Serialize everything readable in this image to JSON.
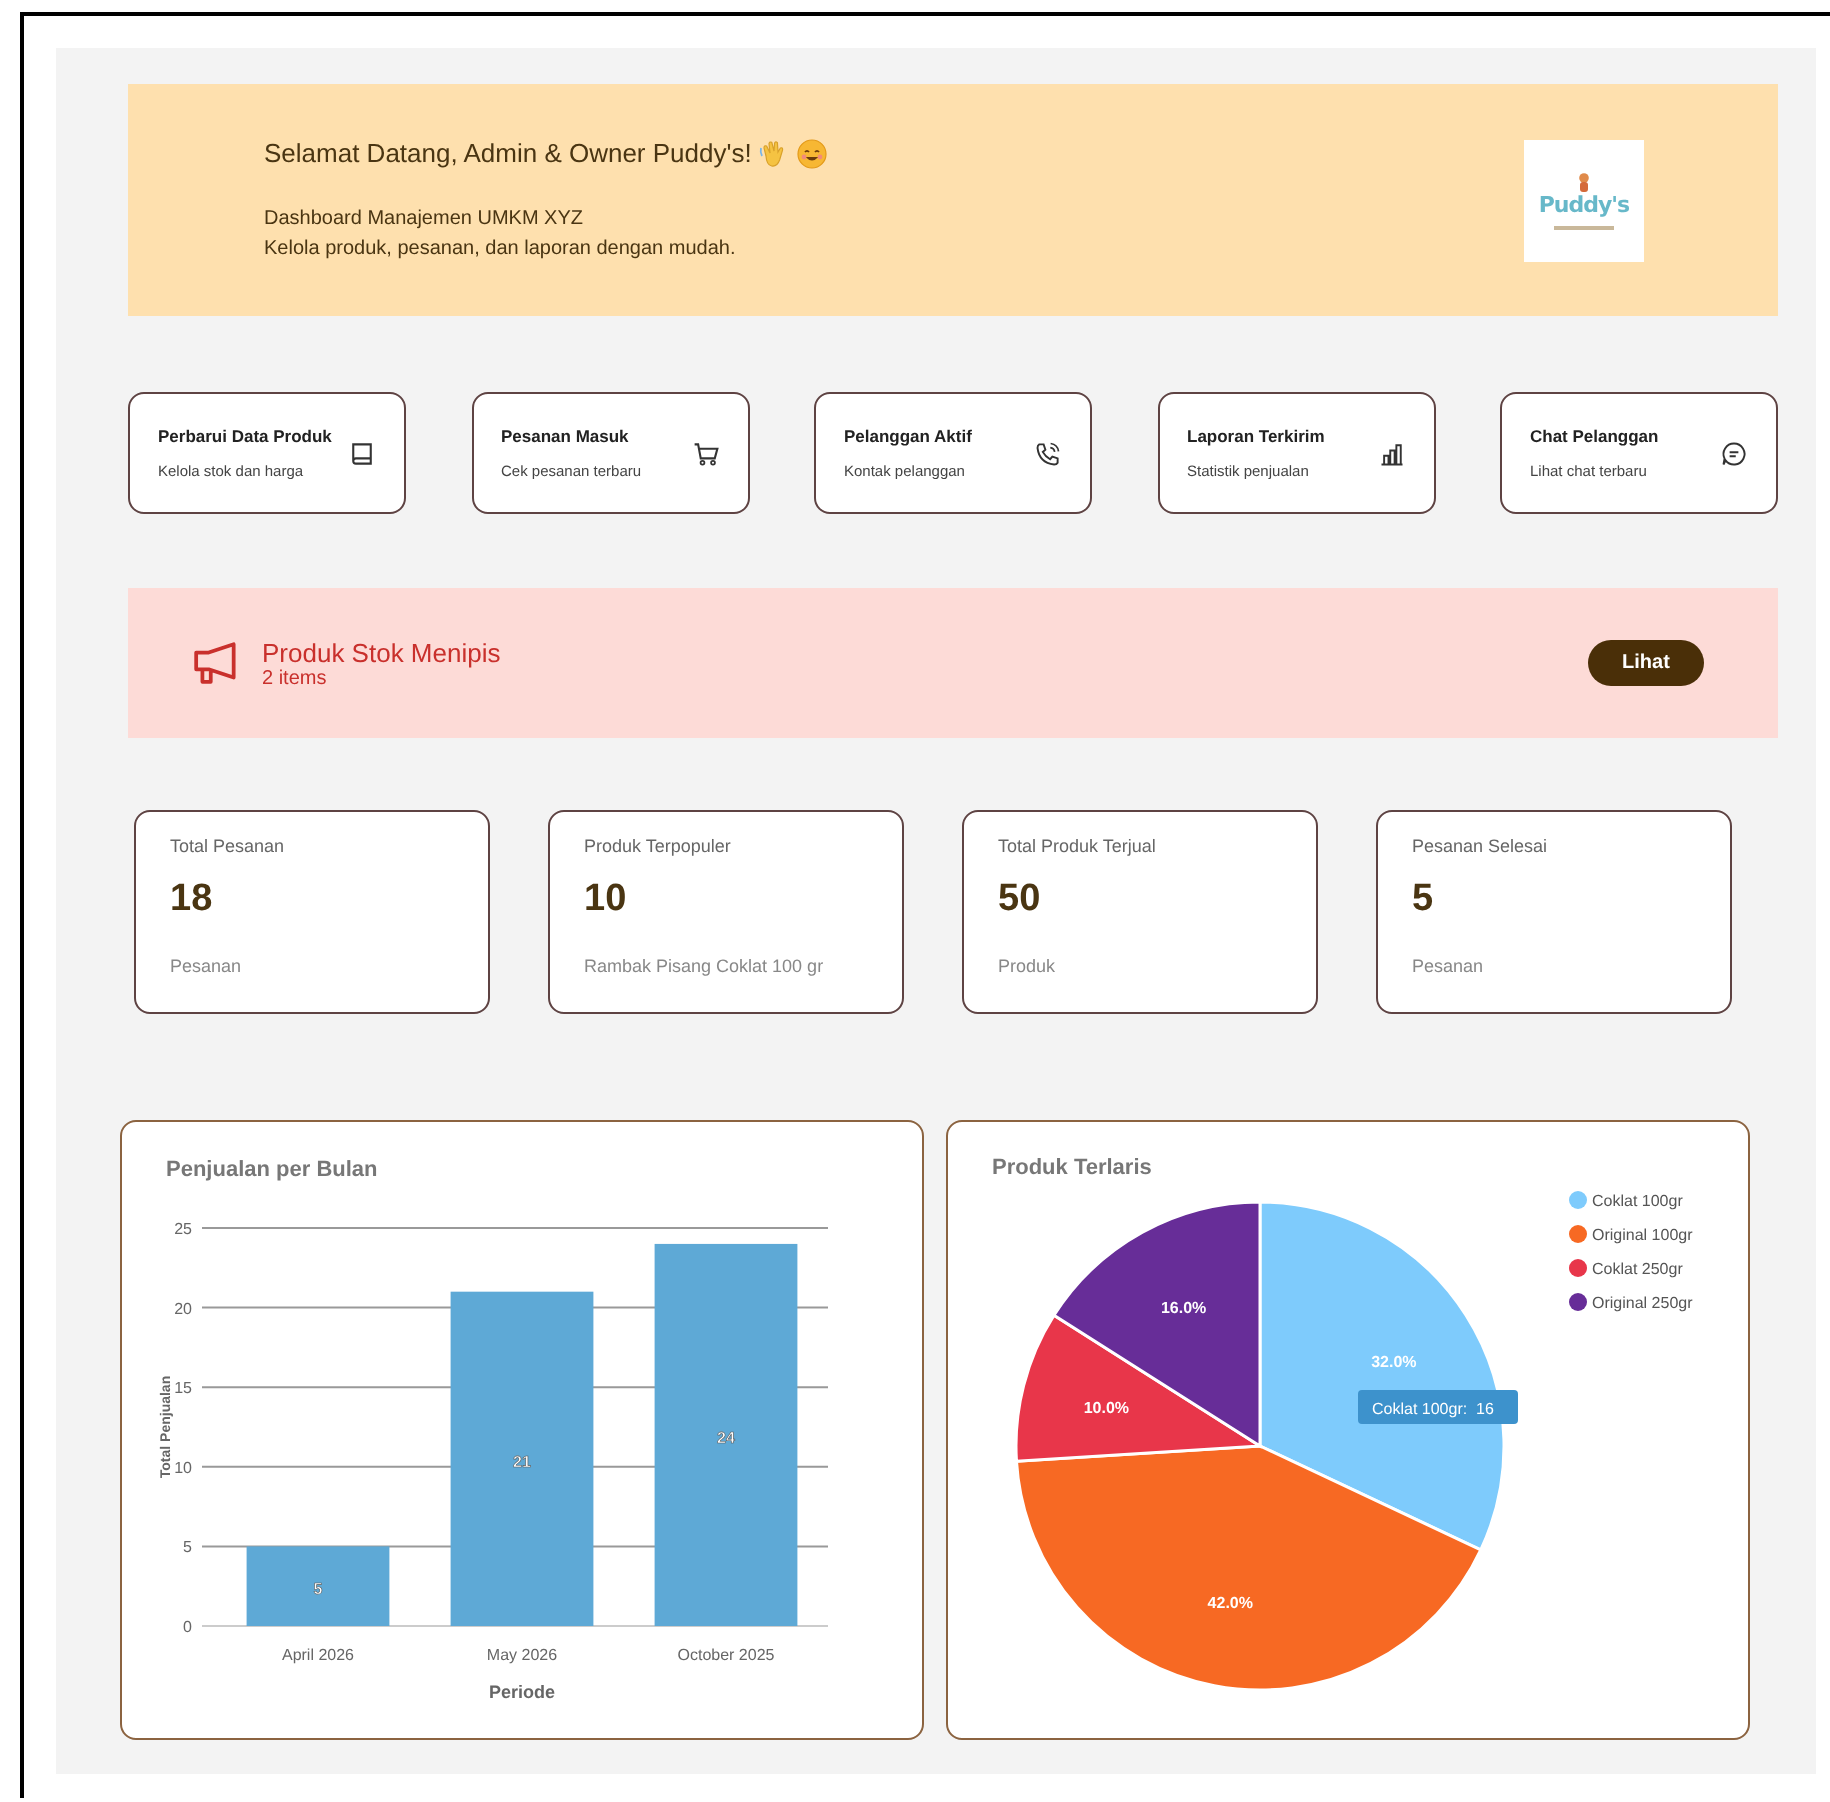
{
  "banner": {
    "greeting": "Selamat Datang, Admin & Owner Puddy's!",
    "subtitle": "Dashboard Manajemen UMKM XYZ",
    "description": "Kelola produk, pesanan, dan laporan dengan mudah.",
    "logo_text": "Puddy's"
  },
  "quick_actions": [
    {
      "title": "Perbarui Data Produk",
      "subtitle": "Kelola stok dan harga"
    },
    {
      "title": "Pesanan Masuk",
      "subtitle": "Cek pesanan terbaru"
    },
    {
      "title": "Pelanggan Aktif",
      "subtitle": "Kontak pelanggan"
    },
    {
      "title": "Laporan Terkirim",
      "subtitle": "Statistik penjualan"
    },
    {
      "title": "Chat Pelanggan",
      "subtitle": "Lihat chat terbaru"
    }
  ],
  "alert": {
    "title": "Produk Stok Menipis",
    "count": "2 items",
    "button": "Lihat"
  },
  "stats": [
    {
      "label": "Total Pesanan",
      "value": "18",
      "caption": "Pesanan"
    },
    {
      "label": "Produk Terpopuler",
      "value": "10",
      "caption": "Rambak Pisang Coklat 100 gr"
    },
    {
      "label": "Total Produk Terjual",
      "value": "50",
      "caption": "Produk"
    },
    {
      "label": "Pesanan Selesai",
      "value": "5",
      "caption": "Pesanan"
    }
  ],
  "sales_chart": {
    "chart_data": {
      "type": "bar",
      "title": "Penjualan per Bulan",
      "xlabel": "Periode",
      "ylabel": "Total Penjualan",
      "categories": [
        "April 2026",
        "May 2026",
        "October 2025"
      ],
      "series": [
        {
          "color": "#5ea9d6",
          "values": [
            5,
            21,
            24
          ]
        }
      ],
      "ylim": [
        0,
        25
      ],
      "yticks": [
        0,
        5,
        10,
        15,
        20,
        25
      ],
      "grid": true,
      "data_labels": true
    }
  },
  "products_chart": {
    "chart_data": {
      "type": "pie",
      "title": "Produk Terlaris",
      "categories": [
        "Coklat 100gr",
        "Original 100gr",
        "Coklat 250gr",
        "Original 250gr"
      ],
      "series": [
        {
          "colors": [
            "#7ecbfc",
            "#f76923",
            "#e8364a",
            "#672d98"
          ],
          "values": [
            32,
            42,
            10,
            16
          ]
        }
      ],
      "value_labels": [
        "32.0%",
        "42.0%",
        "10.0%",
        "16.0%"
      ],
      "legend": true,
      "annotations": [
        {
          "text": "Coklat 100gr:  16"
        }
      ]
    }
  }
}
